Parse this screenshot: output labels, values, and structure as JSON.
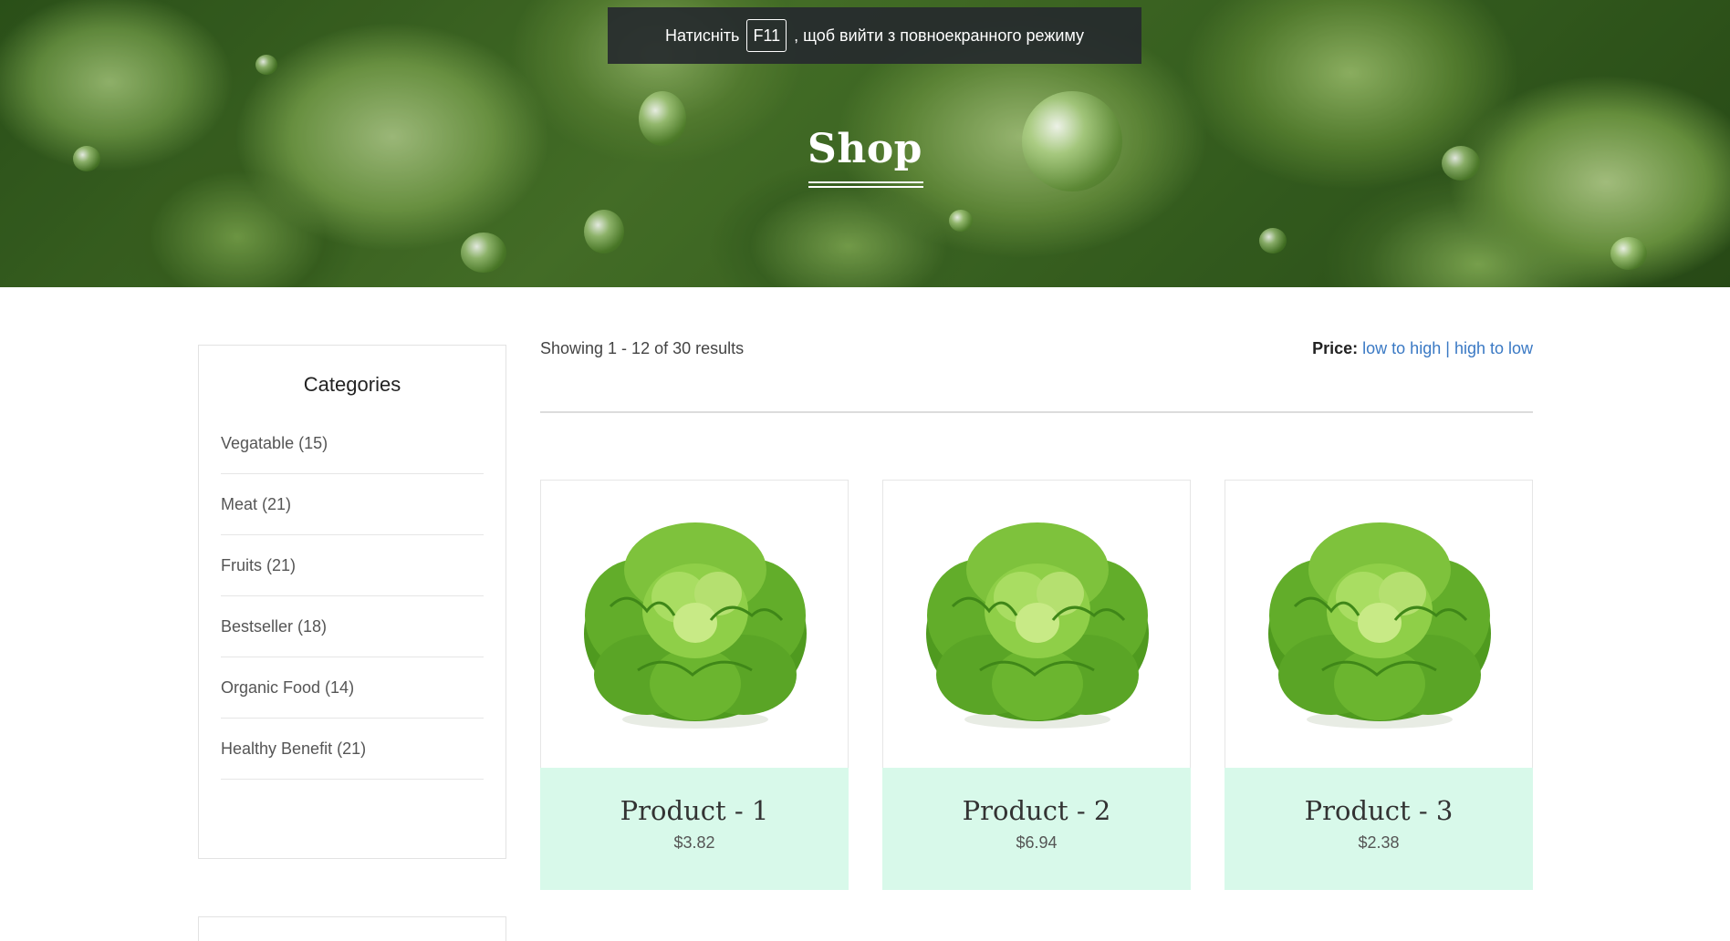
{
  "fullscreen_notice": {
    "prefix": "Натисніть",
    "key": "F11",
    "suffix": ", щоб вийти з повноекранного режиму"
  },
  "hero": {
    "title": "Shop"
  },
  "sidebar": {
    "title": "Categories",
    "categories": [
      {
        "label": "Vegatable (15)"
      },
      {
        "label": "Meat (21)"
      },
      {
        "label": "Fruits (21)"
      },
      {
        "label": "Bestseller (18)"
      },
      {
        "label": "Organic Food (14)"
      },
      {
        "label": "Healthy Benefit (21)"
      }
    ]
  },
  "toolbar": {
    "result_count": "Showing 1 - 12 of 30 results",
    "sort_label": "Price:",
    "sort_low_to_high": "low to high",
    "sort_separator": "|",
    "sort_high_to_low": "high to low"
  },
  "products": [
    {
      "name": "Product - 1",
      "price": "$3.82"
    },
    {
      "name": "Product - 2",
      "price": "$6.94"
    },
    {
      "name": "Product - 3",
      "price": "$2.38"
    }
  ],
  "colors": {
    "card_info_bg": "#d8f9ea",
    "link": "#3a79c4",
    "notice_bg": "#262a2e"
  }
}
